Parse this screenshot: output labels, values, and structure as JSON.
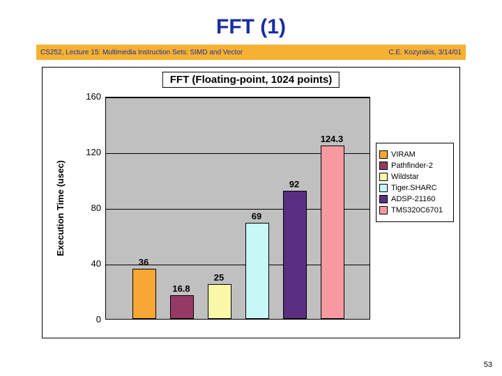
{
  "slide": {
    "title": "FFT (1)",
    "header_left": "CS252, Lecture 15: Multimedia Instruction Sets: SIMD and Vector",
    "header_right": "C.E. Kozyrakis, 3/14/01",
    "page_number": "53"
  },
  "chart_data": {
    "type": "bar",
    "title": "FFT (Floating-point, 1024 points)",
    "xlabel": "",
    "ylabel": "Execution Time (usec)",
    "ylim": [
      0,
      160
    ],
    "yticks": [
      0,
      40,
      80,
      120,
      160
    ],
    "categories": [
      "VIRAM",
      "Pathfinder-2",
      "Wildstar",
      "Tiger.SHARC",
      "ADSP-21160",
      "TMS320C6701"
    ],
    "values": [
      36,
      16.8,
      25,
      69,
      92,
      124.3
    ],
    "colors": [
      "#f7a733",
      "#953a64",
      "#f9f9a9",
      "#c7f7f7",
      "#5a2f81",
      "#f79aa0"
    ],
    "legend_labels": [
      "VIRAM",
      "Pathfinder-2",
      "Wildstar",
      "Tiger.SHARC",
      "ADSP-21160",
      "TMS320C6701"
    ]
  }
}
